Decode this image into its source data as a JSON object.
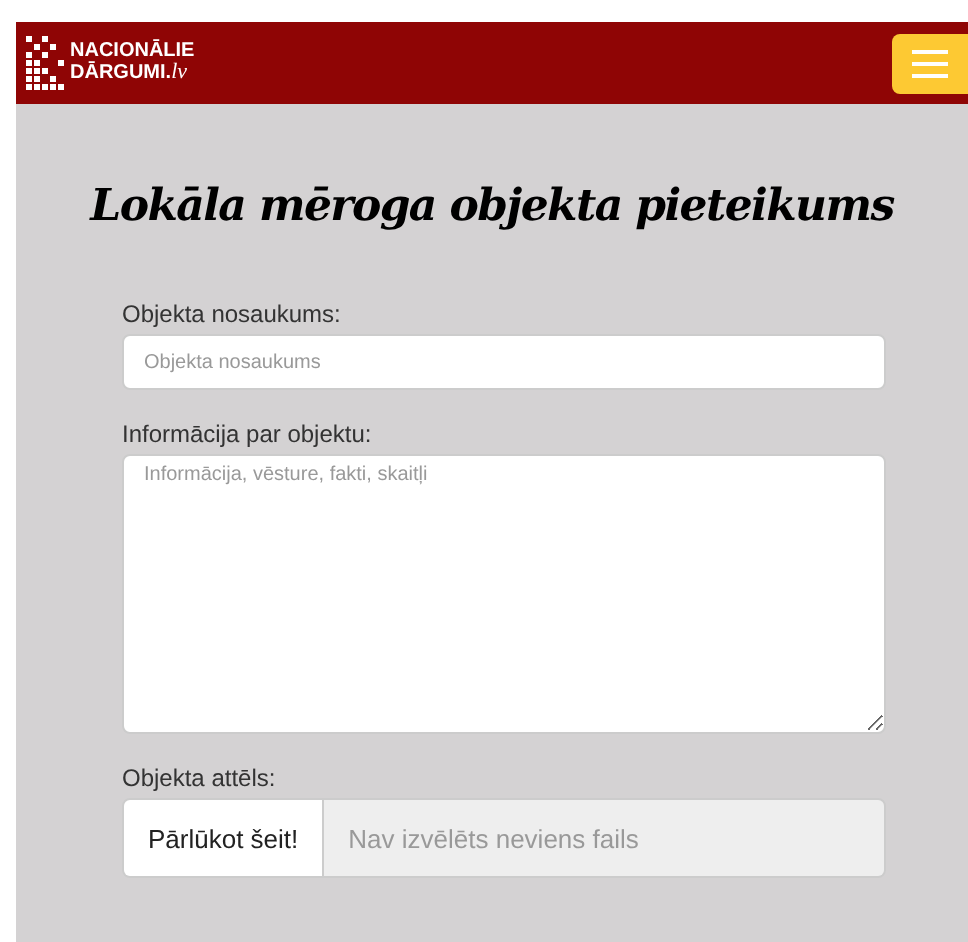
{
  "header": {
    "logo": {
      "line_1": "NACIONĀLIE",
      "line_2": "DĀRGUMI.",
      "suffix": "lv"
    }
  },
  "title": "Lokāla mēroga objekta pieteikums",
  "form": {
    "fields": [
      {
        "kind": "text",
        "label": "Objekta nosaukums:",
        "placeholder": "Objekta nosaukums"
      },
      {
        "kind": "textarea",
        "label": "Informācija par objektu:",
        "placeholder": "Informācija, vēsture, fakti, skaitļi"
      },
      {
        "kind": "file",
        "label": "Objekta attēls:",
        "button": "Pārlūkot šeit!",
        "placeholder": "Nav izvēlēts neviens fails"
      }
    ]
  }
}
